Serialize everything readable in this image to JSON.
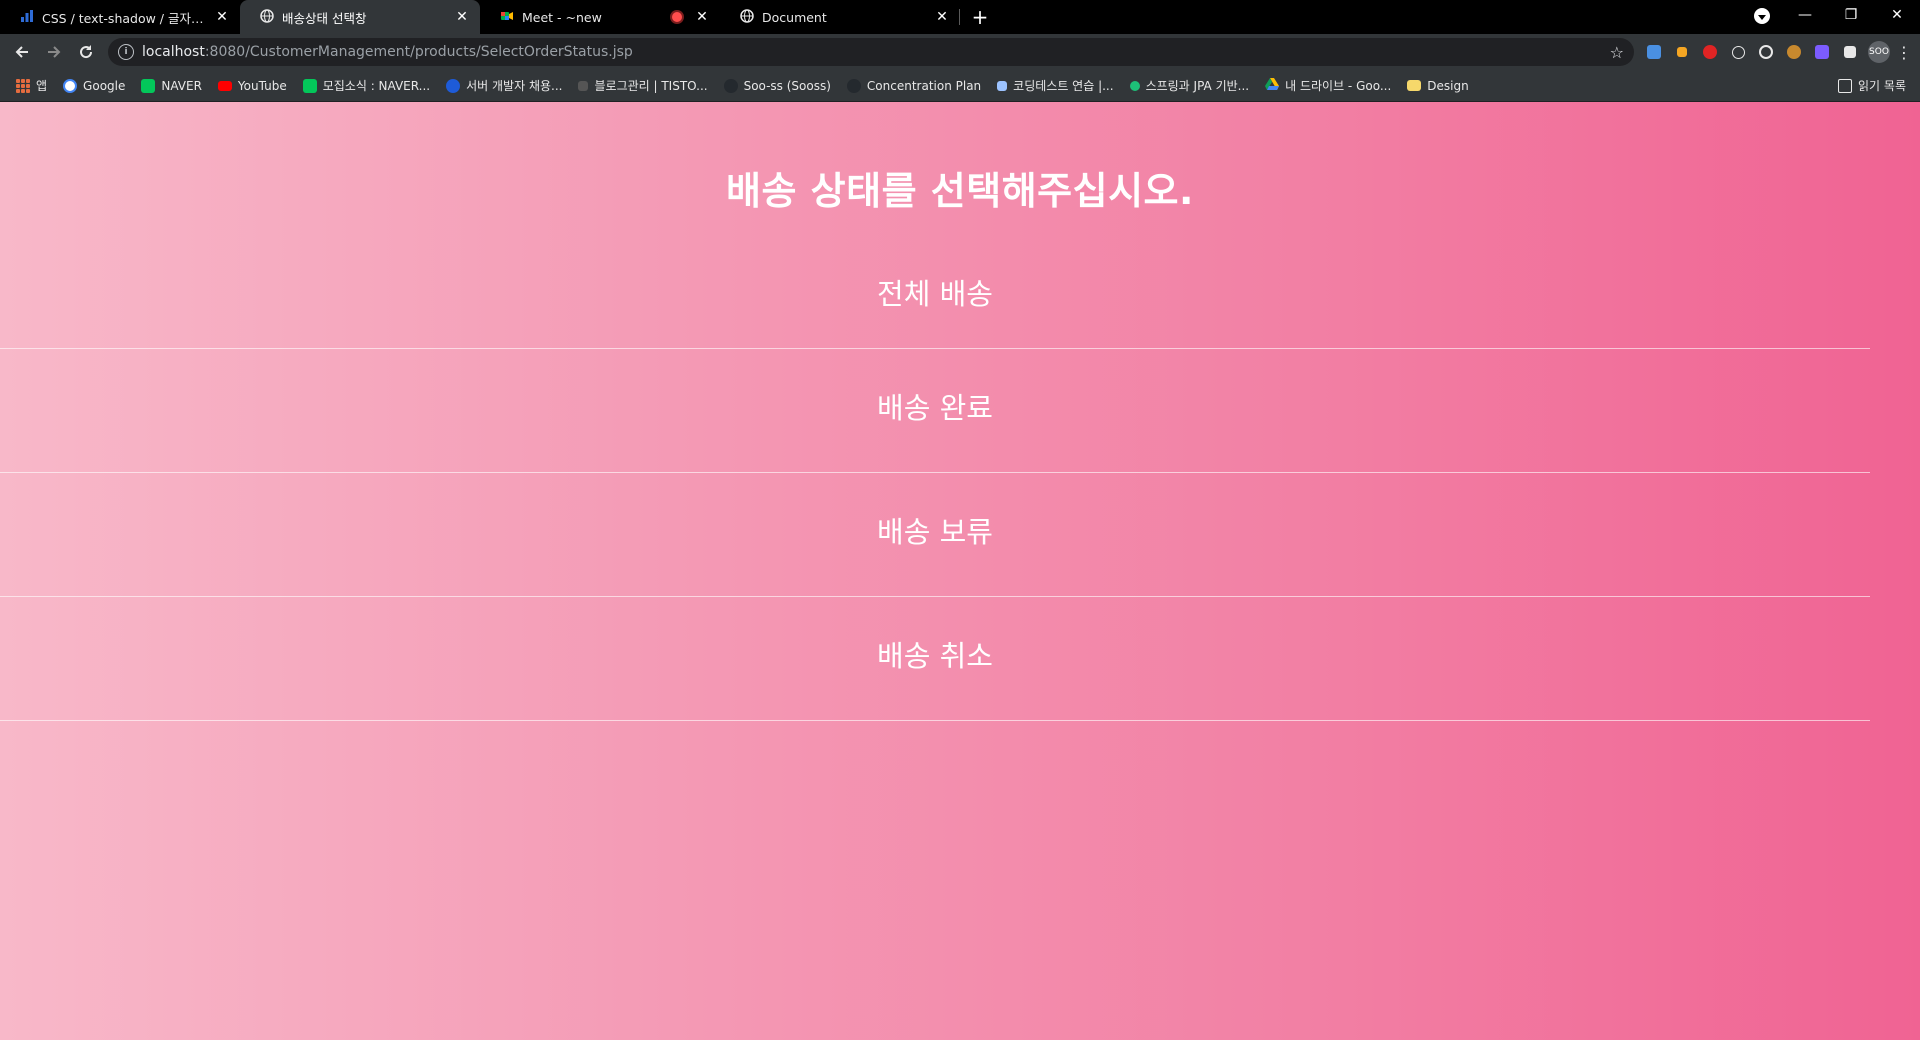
{
  "browser": {
    "tabs": [
      {
        "title": "CSS / text-shadow / 글자에 그림자",
        "favicon": "bar-chart-icon",
        "active": false
      },
      {
        "title": "배송상태 선택창",
        "favicon": "globe-icon",
        "active": true
      },
      {
        "title": "Meet - ~new",
        "favicon": "meet-icon",
        "active": false,
        "recording": true
      },
      {
        "title": "Document",
        "favicon": "globe-icon",
        "active": false
      }
    ],
    "new_tab": "+",
    "window_controls": {
      "minimize": "—",
      "restore": "❐",
      "close": "✕"
    },
    "address": {
      "host": "localhost",
      "path": ":8080/CustomerManagement/products/SelectOrderStatus.jsp"
    },
    "profile_label": "SOO",
    "bookmarks": [
      {
        "label": "앱",
        "icon": "apps-grid-icon",
        "color": "#e56c3f"
      },
      {
        "label": "Google",
        "icon": "google-icon",
        "color": "#ffffff"
      },
      {
        "label": "NAVER",
        "icon": "naver-icon",
        "color": "#03c75a"
      },
      {
        "label": "YouTube",
        "icon": "youtube-icon",
        "color": "#ff0000"
      },
      {
        "label": "모집소식 : NAVER...",
        "icon": "naver-icon",
        "color": "#03c75a"
      },
      {
        "label": "서버 개발자 채용...",
        "icon": "dots-icon",
        "color": "#1e5bd8"
      },
      {
        "label": "블로그관리 | TISTO...",
        "icon": "tistory-icon",
        "color": "#333333"
      },
      {
        "label": "Soo-ss (Sooss)",
        "icon": "github-icon",
        "color": "#24292e"
      },
      {
        "label": "Concentration Plan",
        "icon": "github-icon",
        "color": "#24292e"
      },
      {
        "label": "코딩테스트 연습 |...",
        "icon": "programmers-icon",
        "color": "#9cc3ff"
      },
      {
        "label": "스프링과 JPA 기반...",
        "icon": "inflearn-icon",
        "color": "#1dc078"
      },
      {
        "label": "내 드라이브 - Goo...",
        "icon": "drive-icon",
        "color": "#fbbc04"
      },
      {
        "label": "Design",
        "icon": "folder-icon",
        "color": "#f6d86b"
      }
    ],
    "reading_list": "읽기 목록"
  },
  "page": {
    "title": "배송 상태를 선택해주십시오.",
    "statuses": [
      "전체 배송",
      "배송 완료",
      "배송 보류",
      "배송 취소"
    ]
  },
  "colors": {
    "gradient_start": "#f8b8c9",
    "gradient_end": "#f06393"
  }
}
